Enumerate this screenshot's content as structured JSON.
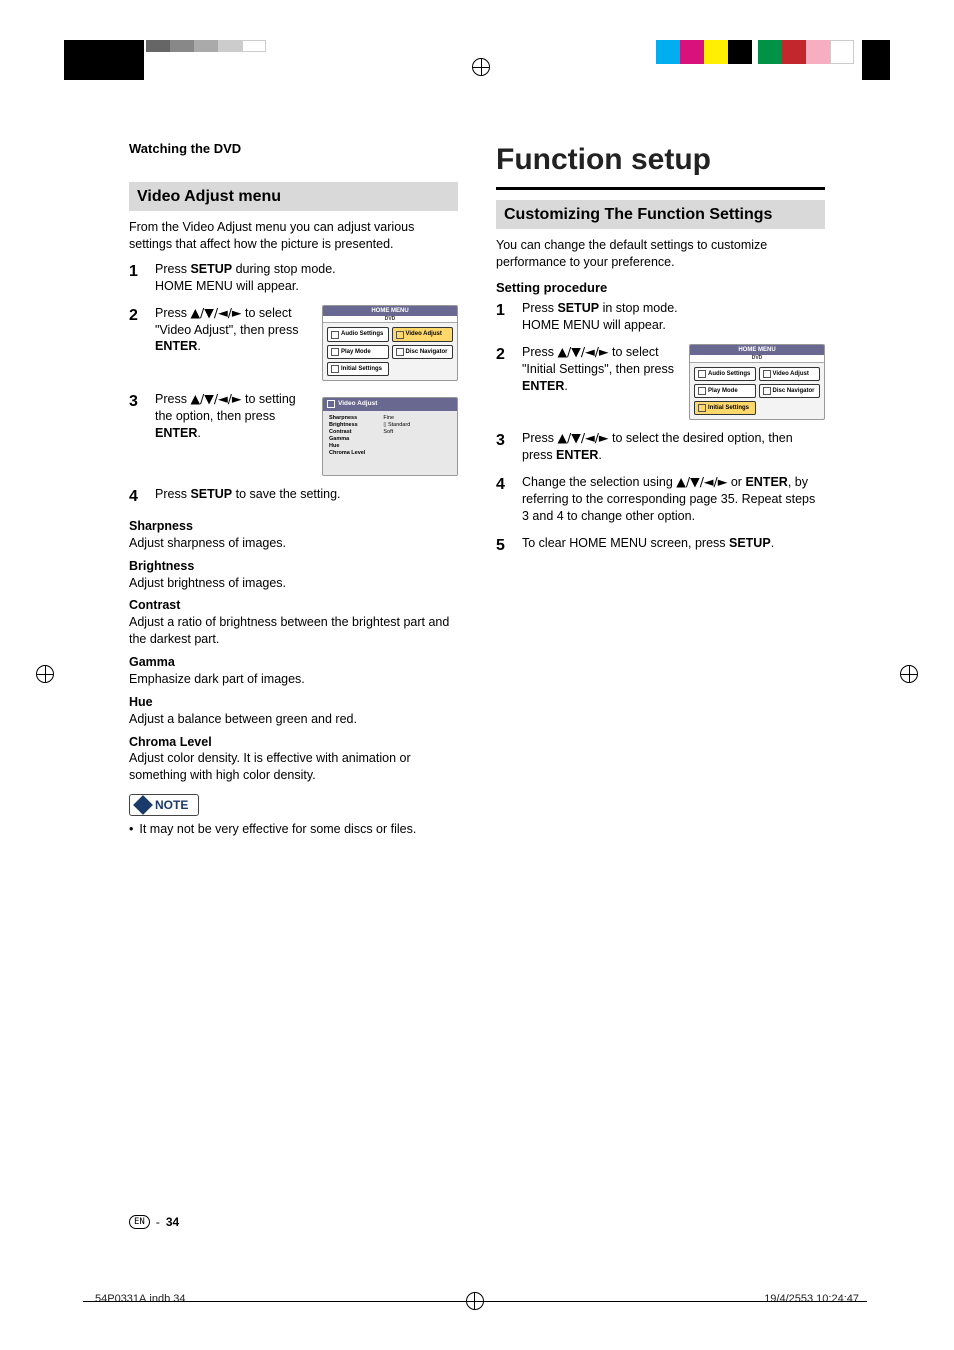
{
  "top_swatches_left": [
    "#000",
    "#000",
    "#000",
    "#000",
    "#000",
    "#444",
    "#777",
    "#aaa",
    "#d0d0d0",
    "#fff"
  ],
  "top_swatches_right": [
    "#00aeef",
    "#d9117d",
    "#ffee00",
    "#000",
    "#009245",
    "#c1272d",
    "#f7aec0",
    "#fff"
  ],
  "left": {
    "chapter": "Watching the DVD",
    "section": "Video Adjust menu",
    "intro": "From the Video Adjust menu you can adjust various settings that affect how the picture is presented.",
    "steps": [
      {
        "n": "1",
        "pre": "Press ",
        "bold1": "SETUP",
        "mid": " during stop mode.",
        "line2": "HOME MENU will appear."
      },
      {
        "n": "2",
        "pre": "Press ",
        "arrows": "▲/▼/◄/►",
        "mid": " to select \"Video Adjust\", then press ",
        "bold2": "ENTER",
        "tail": "."
      },
      {
        "n": "3",
        "pre": "Press ",
        "arrows": "▲/▼/◄/►",
        "mid": " to setting the option, then press ",
        "bold2": "ENTER",
        "tail": "."
      },
      {
        "n": "4",
        "pre": "Press ",
        "bold1": "SETUP",
        "mid": " to save the setting."
      }
    ],
    "home_menu": {
      "title": "HOME MENU",
      "sub": "DVD",
      "items": [
        "Audio Settings",
        "Video Adjust",
        "Play Mode",
        "Disc Navigator",
        "Initial Settings"
      ],
      "selected_index": 1
    },
    "va_menu": {
      "title": "Video Adjust",
      "labels": [
        "Sharpness",
        "Brightness",
        "Contrast",
        "Gamma",
        "Hue",
        "Chroma Level"
      ],
      "values": [
        "Fine",
        "Standard",
        "Soft"
      ]
    },
    "defs": [
      {
        "t": "Sharpness",
        "d": "Adjust sharpness of images."
      },
      {
        "t": "Brightness",
        "d": "Adjust brightness of images."
      },
      {
        "t": "Contrast",
        "d": "Adjust a ratio of brightness between the brightest part and the darkest part."
      },
      {
        "t": "Gamma",
        "d": "Emphasize dark part of images."
      },
      {
        "t": "Hue",
        "d": "Adjust a balance between green and red."
      },
      {
        "t": "Chroma Level",
        "d": "Adjust color density. It is effective with animation or something with high color density."
      }
    ],
    "note_label": "NOTE",
    "note_text": "It may not be very effective for some discs or files."
  },
  "right": {
    "title": "Function setup",
    "section": "Customizing The Function Settings",
    "intro": "You can change the default settings to customize performance to your preference.",
    "sub": "Setting procedure",
    "steps": [
      {
        "n": "1",
        "pre": "Press ",
        "bold1": "SETUP",
        "mid": " in stop mode.",
        "line2": "HOME MENU will appear."
      },
      {
        "n": "2",
        "pre": "Press ",
        "arrows": "▲/▼/◄/►",
        "mid": " to select \"Initial Settings\", then press ",
        "bold2": "ENTER",
        "tail": "."
      },
      {
        "n": "3",
        "pre": "Press ",
        "arrows": "▲/▼/◄/►",
        "mid": " to select the desired option, then press ",
        "bold2": "ENTER",
        "tail": "."
      },
      {
        "n": "4",
        "pre": "Change the selection using ",
        "arrows": "▲/▼/◄/►",
        "mid": " or ",
        "bold2": "ENTER",
        "tail": ", by referring to the corresponding page 35. Repeat steps 3 and 4 to change other option."
      },
      {
        "n": "5",
        "pre": "To clear HOME MENU screen, press ",
        "bold1": "SETUP",
        "tail": "."
      }
    ],
    "home_menu": {
      "title": "HOME MENU",
      "sub": "DVD",
      "items": [
        "Audio Settings",
        "Video Adjust",
        "Play Mode",
        "Disc Navigator",
        "Initial Settings"
      ],
      "selected_index": 4
    }
  },
  "footer": {
    "lang": "EN",
    "sep": "-",
    "page": "34",
    "file": "54P0331A.indb   34",
    "timestamp": "19/4/2553   10:24:47"
  }
}
